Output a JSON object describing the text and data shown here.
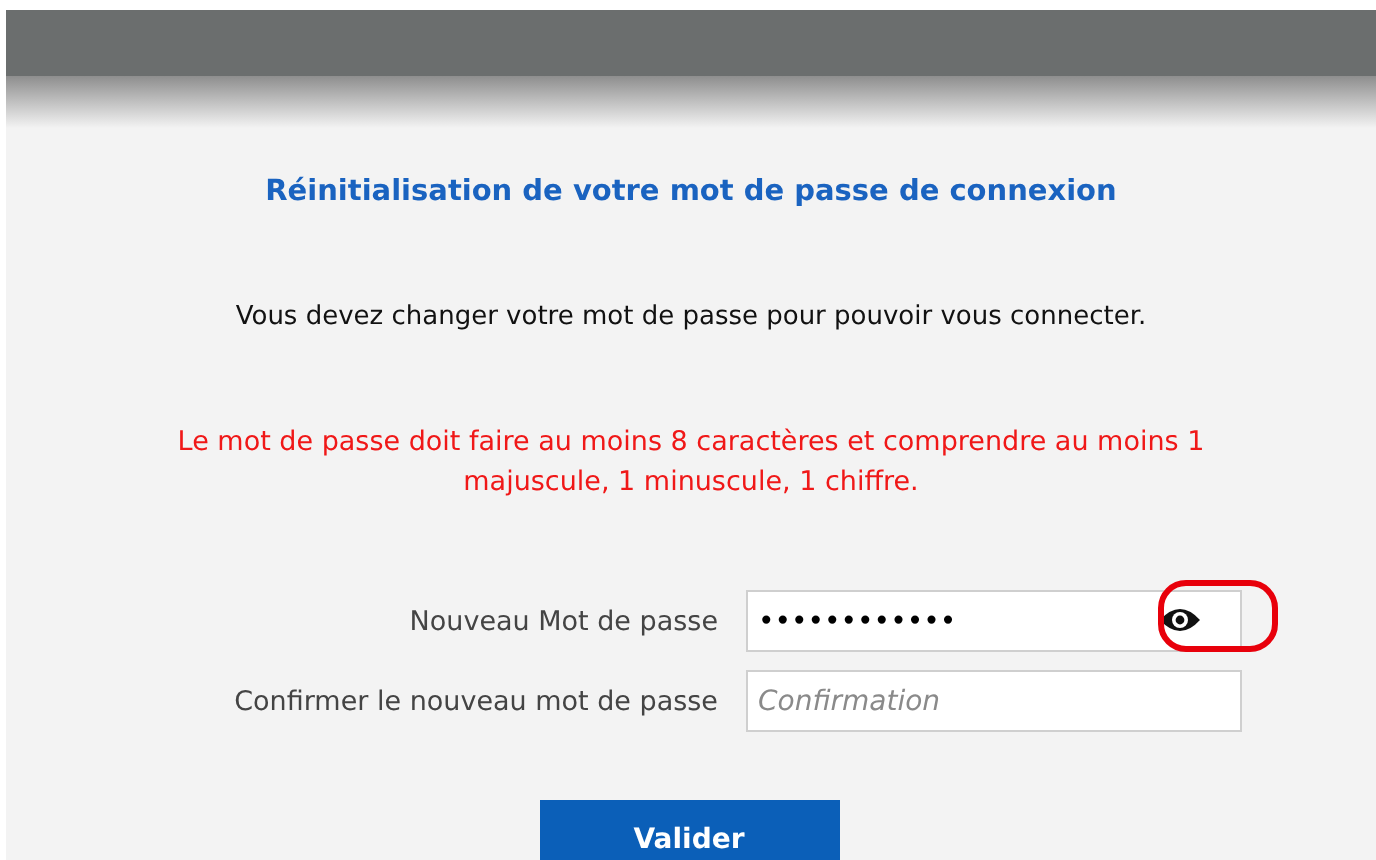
{
  "title": "Réinitialisation de votre mot de passe de connexion",
  "intro": "Vous devez changer votre mot de passe pour pouvoir vous connecter.",
  "rule": "Le mot de passe doit faire au moins 8 caractères et comprendre au moins 1 majuscule, 1 minuscule, 1 chiffre.",
  "fields": [
    {
      "label": "Nouveau Mot de passe",
      "value": "••••••••••••",
      "reveal_toggle": true,
      "highlighted": true
    },
    {
      "label": "Confirmer le nouveau mot de passe",
      "placeholder": "Confirmation",
      "reveal_toggle": false,
      "highlighted": false
    }
  ],
  "submit": "Valider"
}
